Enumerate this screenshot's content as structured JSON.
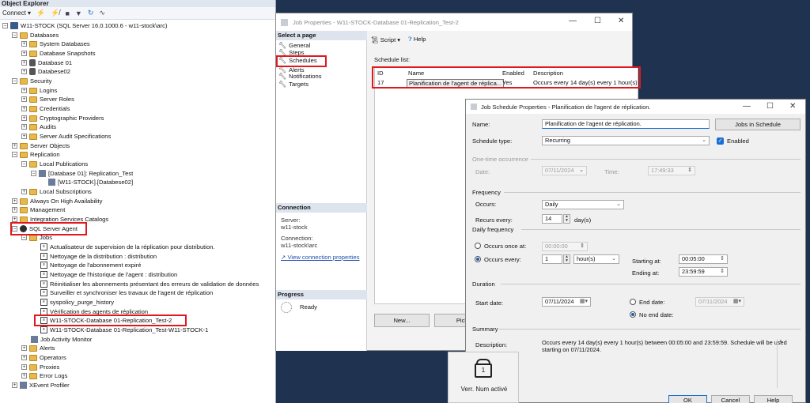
{
  "object_explorer": {
    "title": "Object Explorer",
    "toolbar": {
      "connect_label": "Connect"
    },
    "nodes": [
      {
        "label": "W11-STOCK (SQL Server 16.0.1000.6 - w11-stock\\arc)"
      },
      {
        "label": "Databases"
      },
      {
        "label": "System Databases"
      },
      {
        "label": "Database Snapshots"
      },
      {
        "label": "Database 01"
      },
      {
        "label": "Databese02"
      },
      {
        "label": "Security"
      },
      {
        "label": "Logins"
      },
      {
        "label": "Server Roles"
      },
      {
        "label": "Credentials"
      },
      {
        "label": "Cryptographic Providers"
      },
      {
        "label": "Audits"
      },
      {
        "label": "Server Audit Specifications"
      },
      {
        "label": "Server Objects"
      },
      {
        "label": "Replication"
      },
      {
        "label": "Local Publications"
      },
      {
        "label": "[Database 01]: Replication_Test"
      },
      {
        "label": "[W11-STOCK].[Databese02]"
      },
      {
        "label": "Local Subscriptions"
      },
      {
        "label": "Always On High Availability"
      },
      {
        "label": "Management"
      },
      {
        "label": "Integration Services Catalogs"
      },
      {
        "label": "SQL Server Agent"
      },
      {
        "label": "Jobs"
      },
      {
        "label": "Actualisateur de supervision de la réplication pour distribution."
      },
      {
        "label": "Nettoyage de la distribution : distribution"
      },
      {
        "label": "Nettoyage de l'abonnement expiré"
      },
      {
        "label": "Nettoyage de l'historique de l'agent : distribution"
      },
      {
        "label": "Réinitialiser les abonnements présentant des erreurs de validation de données"
      },
      {
        "label": "Surveiller et synchroniser les travaux de l'agent de réplication"
      },
      {
        "label": "syspolicy_purge_history"
      },
      {
        "label": "Vérification des agents de réplication"
      },
      {
        "label": "W11-STOCK-Database 01-Replication_Test-2"
      },
      {
        "label": "W11-STOCK-Database 01-Replication_Test-W11-STOCK-1"
      },
      {
        "label": "Job Activity Monitor"
      },
      {
        "label": "Alerts"
      },
      {
        "label": "Operators"
      },
      {
        "label": "Proxies"
      },
      {
        "label": "Error Logs"
      },
      {
        "label": "XEvent Profiler"
      }
    ]
  },
  "job_properties": {
    "title": "Job Properties - W11-STOCK-Database 01-Replication_Test-2",
    "select_page_header": "Select a page",
    "pages": [
      "General",
      "Steps",
      "Schedules",
      "Alerts",
      "Notifications",
      "Targets"
    ],
    "toolbar": {
      "script_label": "Script",
      "help_label": "Help"
    },
    "schedule_list_label": "Schedule list:",
    "columns": [
      "ID",
      "Name",
      "Enabled",
      "Description"
    ],
    "rows": [
      {
        "id": "17",
        "name": "Planification de l'agent de réplica...",
        "enabled": "Yes",
        "description": "Occurs every 14 day(s) every 1 hour(s)"
      }
    ],
    "connection": {
      "header": "Connection",
      "server_label": "Server:",
      "server_value": "w11-stock",
      "connection_label": "Connection:",
      "connection_value": "w11-stock\\arc",
      "view_link": "View connection properties"
    },
    "progress": {
      "header": "Progress",
      "status": "Ready"
    },
    "buttons": {
      "new_label": "New...",
      "pick_label": "Pick"
    }
  },
  "job_schedule": {
    "title": "Job Schedule Properties - Planification de l'agent de réplication.",
    "name_label": "Name:",
    "name_value": "Planification de l'agent de réplication.",
    "jobs_in_schedule_label": "Jobs in Schedule",
    "schedule_type_label": "Schedule type:",
    "schedule_type_value": "Recurring",
    "enabled_label": "Enabled",
    "one_time_header": "One-time occurrence",
    "date_label": "Date:",
    "date_value": "07/11/2024",
    "time_label": "Time:",
    "time_value": "17:49:33",
    "frequency_header": "Frequency",
    "occurs_label": "Occurs:",
    "occurs_value": "Daily",
    "recurs_every_label": "Recurs every:",
    "recurs_every_value": "14",
    "recurs_unit": "day(s)",
    "daily_frequency_header": "Daily frequency",
    "occurs_once_label": "Occurs once at:",
    "occurs_once_value": "00:00:00",
    "occurs_every_label": "Occurs every:",
    "occurs_every_value": "1",
    "occurs_every_unit": "hour(s)",
    "starting_at_label": "Starting at:",
    "starting_at_value": "00:05:00",
    "ending_at_label": "Ending at:",
    "ending_at_value": "23:59:59",
    "duration_header": "Duration",
    "start_date_label": "Start date:",
    "start_date_value": "07/11/2024",
    "end_date_label": "End date:",
    "end_date_value": "07/11/2024",
    "no_end_date_label": "No end date:",
    "summary_header": "Summary",
    "description_label": "Description:",
    "description_value": "Occurs every 14 day(s) every 1 hour(s) between 00:05:00 and 23:59:59. Schedule will be used starting on 07/11/2024.",
    "ok_label": "OK",
    "cancel_label": "Cancel",
    "help_label": "Help"
  },
  "toast": {
    "text": "Verr. Num activé",
    "badge": "1"
  }
}
